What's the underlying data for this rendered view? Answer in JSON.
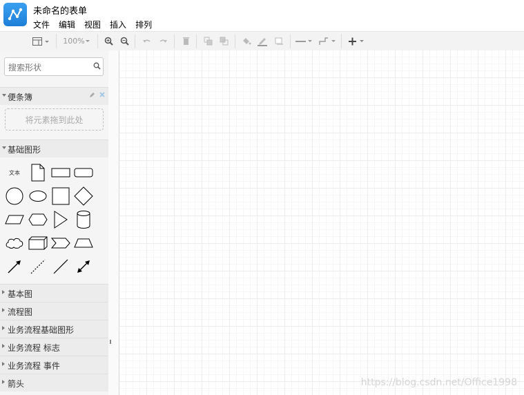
{
  "app": {
    "title": "未命名的表单"
  },
  "menu": {
    "items": [
      "文件",
      "编辑",
      "视图",
      "插入",
      "排列"
    ]
  },
  "toolbar": {
    "zoom": "100%"
  },
  "sidebar": {
    "search_placeholder": "搜索形状",
    "scratchpad": {
      "title": "便条簿",
      "drop_hint": "将元素拖到此处"
    },
    "general": {
      "title": "基础图形",
      "text_shape": "文本"
    },
    "sections": [
      "基本图",
      "流程图",
      "业务流程基础图形",
      "业务流程 标志",
      "业务流程 事件",
      "箭头"
    ]
  },
  "watermark": "https://blog.csdn.net/Office1998"
}
